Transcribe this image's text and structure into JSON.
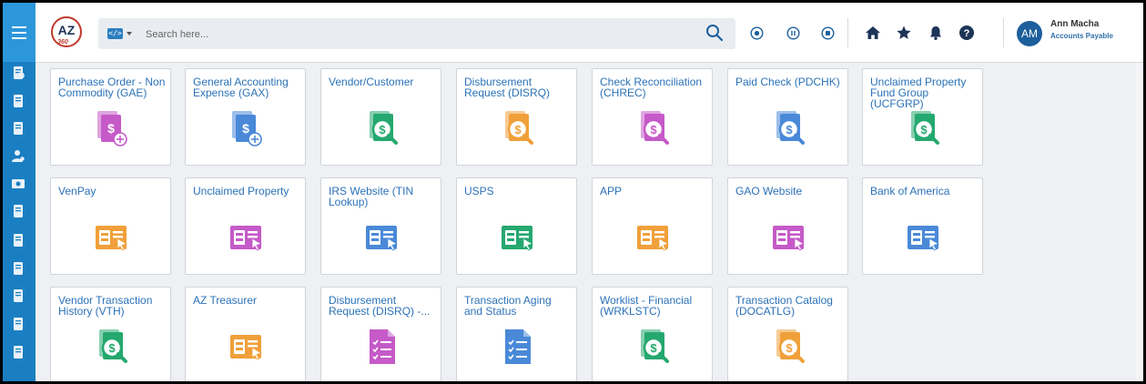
{
  "brand": {
    "logo_text": "AZ",
    "logo_sub": "360"
  },
  "search": {
    "placeholder": "Search here..."
  },
  "user": {
    "initials": "AM",
    "name": "Ann Macha",
    "role": "Accounts Payable"
  },
  "colors": {
    "rail": "#1a7fc2",
    "link": "#2b72b8",
    "purple": "#c55ac8",
    "blue": "#4a89d8",
    "green": "#25a86f",
    "orange": "#f0a03a",
    "navy": "#1d3557"
  },
  "rail_icons": [
    "search-doc-icon",
    "file-icon",
    "file-icon",
    "users-icon",
    "money-icon",
    "document-icon",
    "doc-settings-icon",
    "docs-icon",
    "docs-icon",
    "doc-user-icon",
    "doc-check-icon"
  ],
  "tiles": [
    {
      "label": "Purchase Order - Non Commodity (GAE)",
      "icon": "money-doc-add",
      "color": "purple"
    },
    {
      "label": "General Accounting Expense (GAX)",
      "icon": "money-doc-add",
      "color": "blue"
    },
    {
      "label": "Vendor/Customer",
      "icon": "money-search",
      "color": "green"
    },
    {
      "label": "Disbursement Request (DISRQ)",
      "icon": "money-search",
      "color": "orange"
    },
    {
      "label": "Check Reconciliation (CHREC)",
      "icon": "money-search",
      "color": "purple"
    },
    {
      "label": "Paid Check (PDCHK)",
      "icon": "money-search",
      "color": "blue"
    },
    {
      "label": "Unclaimed Property Fund Group (UCFGRP)",
      "icon": "money-search",
      "color": "green"
    },
    {
      "label": "VenPay",
      "icon": "web-form",
      "color": "orange"
    },
    {
      "label": "Unclaimed Property",
      "icon": "web-form",
      "color": "purple"
    },
    {
      "label": "IRS Website (TIN Lookup)",
      "icon": "web-form",
      "color": "blue"
    },
    {
      "label": "USPS",
      "icon": "web-form",
      "color": "green"
    },
    {
      "label": "APP",
      "icon": "web-form",
      "color": "orange"
    },
    {
      "label": "GAO Website",
      "icon": "web-form",
      "color": "purple"
    },
    {
      "label": "Bank of America",
      "icon": "web-form",
      "color": "blue"
    },
    {
      "label": "Vendor Transaction History (VTH)",
      "icon": "money-search",
      "color": "green"
    },
    {
      "label": "AZ Treasurer",
      "icon": "web-form",
      "color": "orange"
    },
    {
      "label": "Disbursement Request (DISRQ) -...",
      "icon": "checklist",
      "color": "purple"
    },
    {
      "label": "Transaction Aging and Status",
      "icon": "checklist",
      "color": "blue"
    },
    {
      "label": "Worklist - Financial (WRKLSTC)",
      "icon": "money-search",
      "color": "green"
    },
    {
      "label": "Transaction Catalog (DOCATLG)",
      "icon": "money-search",
      "color": "orange"
    }
  ]
}
